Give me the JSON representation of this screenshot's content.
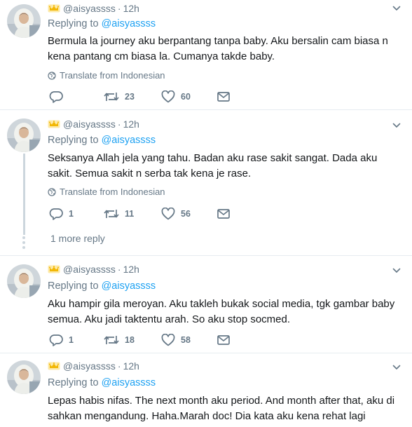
{
  "tweets": [
    {
      "handle": "@aisyassss",
      "time": "12h",
      "replying_prefix": "Replying to",
      "replying_to": "@aisyassss",
      "text": "Bermula la journey aku berpantang tanpa baby. Aku bersalin cam biasa n kena pantang cm biasa la. Cumanya takde baby.",
      "translate": "Translate from Indonesian",
      "replies": "",
      "retweets": "23",
      "likes": "60"
    },
    {
      "handle": "@aisyassss",
      "time": "12h",
      "replying_prefix": "Replying to",
      "replying_to": "@aisyassss",
      "text": "Seksanya Allah jela yang tahu. Badan aku rase sakit sangat. Dada aku sakit. Semua sakit n serba tak kena je rase.",
      "translate": "Translate from Indonesian",
      "replies": "1",
      "retweets": "11",
      "likes": "56"
    },
    {
      "handle": "@aisyassss",
      "time": "12h",
      "replying_prefix": "Replying to",
      "replying_to": "@aisyassss",
      "text": "Aku hampir gila meroyan. Aku takleh bukak social media,  tgk gambar baby semua. Aku jadi taktentu arah. So aku stop socmed.",
      "replies": "1",
      "retweets": "18",
      "likes": "58"
    },
    {
      "handle": "@aisyassss",
      "time": "12h",
      "replying_prefix": "Replying to",
      "replying_to": "@aisyassss",
      "text": "Lepas habis nifas. The next month aku period. And month after that,  aku di sahkan mengandung. Haha.Marah doc!  Dia kata aku kena rehat lagi"
    }
  ],
  "more_reply": "1 more reply",
  "icons": {
    "reply": "reply-icon",
    "retweet": "retweet-icon",
    "like": "heart-icon",
    "dm": "envelope-icon",
    "translate": "globe-icon",
    "badge": "crown-icon",
    "menu": "chevron-down-icon"
  },
  "colors": {
    "secondary_text": "#657786",
    "link": "#1da1f2",
    "divider": "#e6ecf0",
    "badge": "#f5c518"
  }
}
